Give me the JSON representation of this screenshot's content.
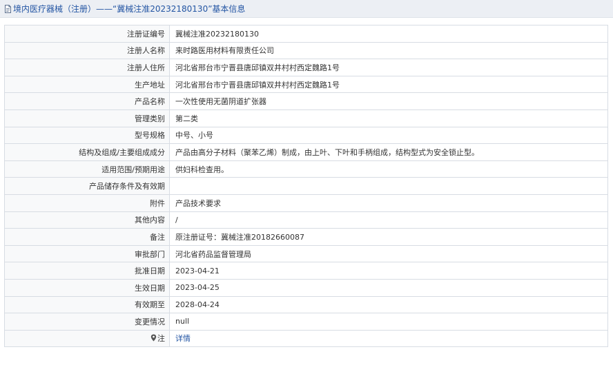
{
  "header": {
    "title": "境内医疗器械（注册）——“冀械注准20232180130”基本信息",
    "icon": "document-icon"
  },
  "rows": [
    {
      "label": "注册证编号",
      "value": "冀械注准20232180130"
    },
    {
      "label": "注册人名称",
      "value": "来时路医用材料有限责任公司"
    },
    {
      "label": "注册人住所",
      "value": "河北省邢台市宁晋县唐邱镇双井村村西定魏路1号"
    },
    {
      "label": "生产地址",
      "value": "河北省邢台市宁晋县唐邱镇双井村村西定魏路1号"
    },
    {
      "label": "产品名称",
      "value": "一次性使用无菌阴道扩张器"
    },
    {
      "label": "管理类别",
      "value": "第二类"
    },
    {
      "label": "型号规格",
      "value": "中号、小号"
    },
    {
      "label": "结构及组成/主要组成成分",
      "value": "产品由高分子材料（聚苯乙烯）制成，由上叶、下叶和手柄组成，结构型式为安全锁止型。"
    },
    {
      "label": "适用范围/预期用途",
      "value": "供妇科检查用。"
    },
    {
      "label": "产品储存条件及有效期",
      "value": ""
    },
    {
      "label": "附件",
      "value": "产品技术要求"
    },
    {
      "label": "其他内容",
      "value": "/"
    },
    {
      "label": "备注",
      "value": "原注册证号：冀械注准20182660087"
    },
    {
      "label": "审批部门",
      "value": "河北省药品监督管理局"
    },
    {
      "label": "批准日期",
      "value": "2023-04-21"
    },
    {
      "label": "生效日期",
      "value": "2023-04-25"
    },
    {
      "label": "有效期至",
      "value": "2028-04-24"
    },
    {
      "label": "变更情况",
      "value": "null"
    }
  ],
  "note_row": {
    "label": "注",
    "icon": "map-pin-icon",
    "link_text": "详情"
  },
  "colors": {
    "title_text": "#2355a3",
    "link": "#2355a3",
    "border": "#d7dce3",
    "header_bg": "#eceff4"
  }
}
